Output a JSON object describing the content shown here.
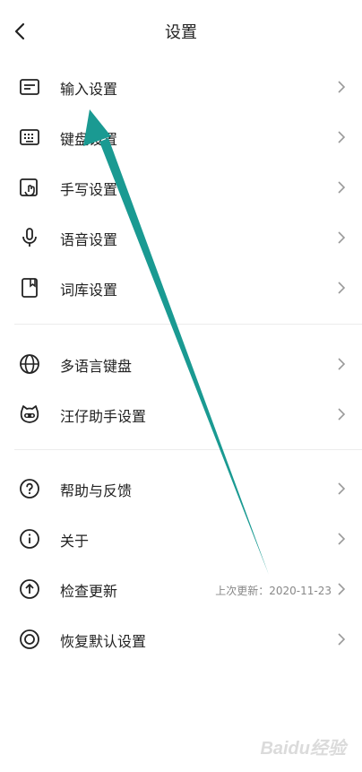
{
  "header": {
    "title": "设置",
    "back_icon": "chevron-left-icon"
  },
  "groups": [
    {
      "items": [
        {
          "label": "输入设置",
          "icon": "keyboard-input-icon"
        },
        {
          "label": "键盘设置",
          "icon": "keyboard-icon"
        },
        {
          "label": "手写设置",
          "icon": "handwriting-icon"
        },
        {
          "label": "语音设置",
          "icon": "microphone-icon"
        },
        {
          "label": "词库设置",
          "icon": "dictionary-icon"
        }
      ]
    },
    {
      "items": [
        {
          "label": "多语言键盘",
          "icon": "globe-icon"
        },
        {
          "label": "汪仔助手设置",
          "icon": "mascot-icon"
        }
      ]
    },
    {
      "items": [
        {
          "label": "帮助与反馈",
          "icon": "help-icon"
        },
        {
          "label": "关于",
          "icon": "info-icon"
        },
        {
          "label": "检查更新",
          "icon": "upload-icon",
          "meta": "上次更新：2020-11-23"
        },
        {
          "label": "恢复默认设置",
          "icon": "restore-icon"
        }
      ]
    }
  ],
  "watermark": "Baidu经验",
  "colors": {
    "arrow": "#1a9a92",
    "text": "#222222",
    "meta": "#888888",
    "chevron": "#999999"
  }
}
